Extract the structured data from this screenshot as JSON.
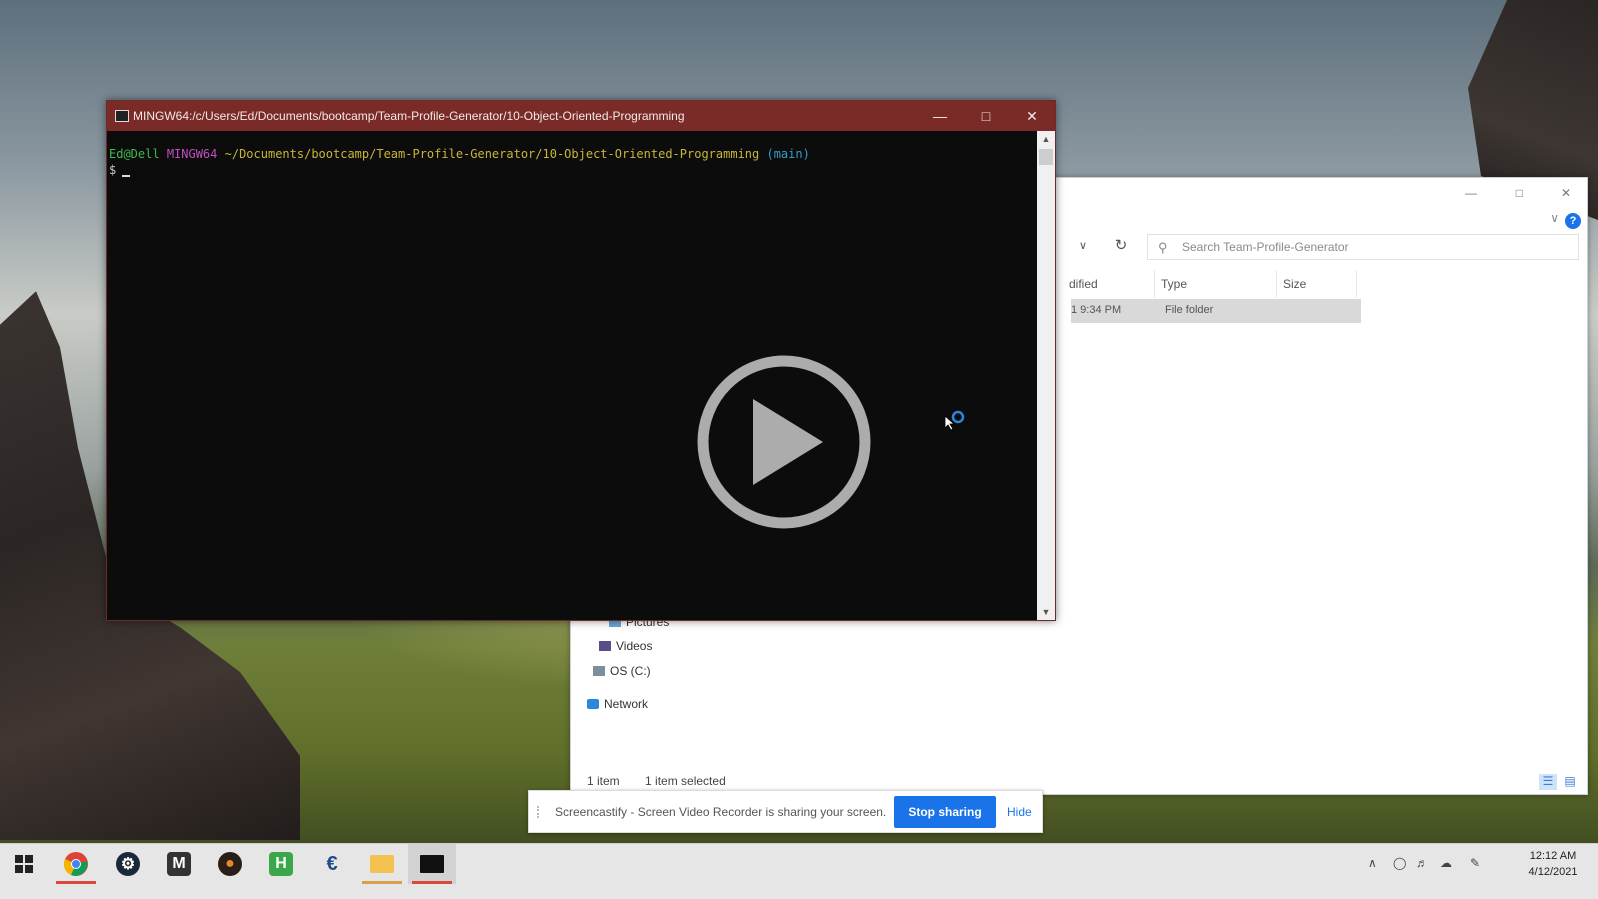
{
  "terminal": {
    "title": "MINGW64:/c/Users/Ed/Documents/bootcamp/Team-Profile-Generator/10-Object-Oriented-Programming",
    "prompt_user": "Ed@Dell",
    "prompt_env": "MINGW64",
    "prompt_path": "~/Documents/bootcamp/Team-Profile-Generator/10-Object-Oriented-Programming",
    "prompt_branch": "(main)",
    "prompt_symbol": "$"
  },
  "explorer": {
    "search_placeholder": "Search Team-Profile-Generator",
    "columns": {
      "modified": "dified",
      "type": "Type",
      "size": "Size"
    },
    "row": {
      "modified": "1 9:34 PM",
      "type": "File folder"
    },
    "nav": {
      "pictures": "Pictures",
      "videos": "Videos",
      "os_drive": "OS (C:)",
      "network": "Network"
    },
    "status": {
      "items": "1 item",
      "selected": "1 item selected"
    }
  },
  "share_bar": {
    "message": "Screencastify - Screen Video Recorder is sharing your screen.",
    "stop_label": "Stop sharing",
    "hide_label": "Hide"
  },
  "taskbar": {
    "apps": [
      "windows-start",
      "chrome",
      "steam",
      "m-app",
      "hedgehog-app",
      "h-app",
      "e-app",
      "file-explorer",
      "terminal"
    ],
    "clock_time": "12:12 AM",
    "clock_date": "4/12/2021"
  },
  "colors": {
    "terminal_title_bar": "#7a2b28",
    "accent_blue": "#1a73e8",
    "taskbar_bg": "#e6e6e6"
  }
}
